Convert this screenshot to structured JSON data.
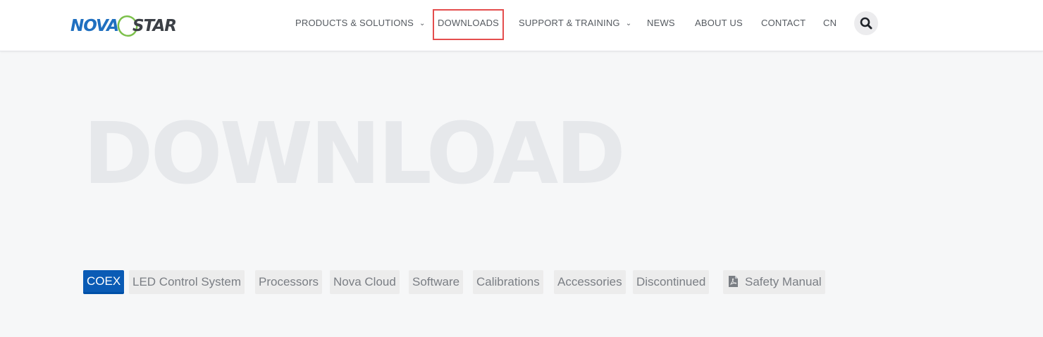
{
  "header": {
    "logo_text": "NOVASTAR",
    "nav": [
      {
        "label": "PRODUCTS & SOLUTIONS",
        "has_dropdown": true
      },
      {
        "label": "DOWNLOADS",
        "has_dropdown": false
      },
      {
        "label": "SUPPORT & TRAINING",
        "has_dropdown": true
      },
      {
        "label": "NEWS",
        "has_dropdown": false
      },
      {
        "label": "ABOUT US",
        "has_dropdown": false
      },
      {
        "label": "CONTACT",
        "has_dropdown": false
      },
      {
        "label": "CN",
        "has_dropdown": false
      }
    ],
    "search_icon": "search-icon",
    "highlight_color": "#e44d4d"
  },
  "hero": {
    "title": "DOWNLOAD"
  },
  "tabs": [
    {
      "label": "COEX",
      "active": true
    },
    {
      "label": "LED Control System",
      "active": false
    },
    {
      "label": "Processors",
      "active": false
    },
    {
      "label": "Nova Cloud",
      "active": false
    },
    {
      "label": "Software",
      "active": false
    },
    {
      "label": "Calibrations",
      "active": false
    },
    {
      "label": "Accessories",
      "active": false
    },
    {
      "label": "Discontinued",
      "active": false
    },
    {
      "label": "Safety Manual",
      "active": false,
      "icon": "pdf-file-icon"
    }
  ],
  "colors": {
    "accent": "#0a5bb5",
    "logo_blue": "#1f6fc0",
    "logo_green": "#7bc04a",
    "hero_text": "#e6e8eb"
  }
}
